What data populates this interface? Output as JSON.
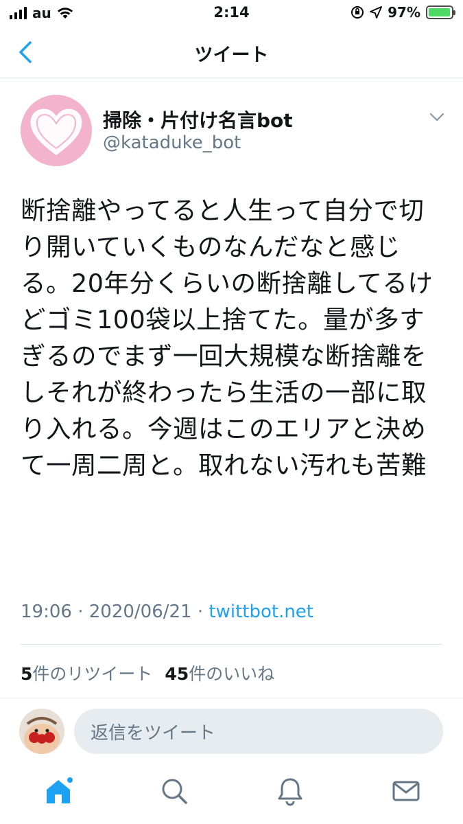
{
  "status_bar": {
    "carrier": "au",
    "time": "2:14",
    "battery": "97%",
    "battery_level": 0.97
  },
  "nav": {
    "title": "ツイート",
    "back_icon": "chevron-left-icon"
  },
  "tweet": {
    "author_name": "掃除・片付け名言bot",
    "author_handle": "@kataduke_bot",
    "text": "断捨離やってると人生って自分で切り開いていくものなんだなと感じる。20年分くらいの断捨離してるけどゴミ100袋以上捨てた。量が多すぎるのでまず一回大規模な断捨離をしそれが終わったら生活の一部に取り入れる。今週はこのエリアと決めて一周二周と。取れない汚れも苦難",
    "time": "19:06",
    "date": "2020/06/21",
    "separator": "·",
    "source": "twittbot.net"
  },
  "stats": {
    "retweet_count": "5",
    "retweet_label": "件のリツイート",
    "like_count": "45",
    "like_label": "件のいいね"
  },
  "reply": {
    "placeholder": "返信をツイート"
  },
  "tab_bar": {
    "items": [
      "home-icon",
      "search-icon",
      "bell-icon",
      "mail-icon"
    ]
  },
  "colors": {
    "accent": "#1da1f2",
    "secondary_text": "#657786",
    "avatar_bg": "#f2b3cb"
  }
}
